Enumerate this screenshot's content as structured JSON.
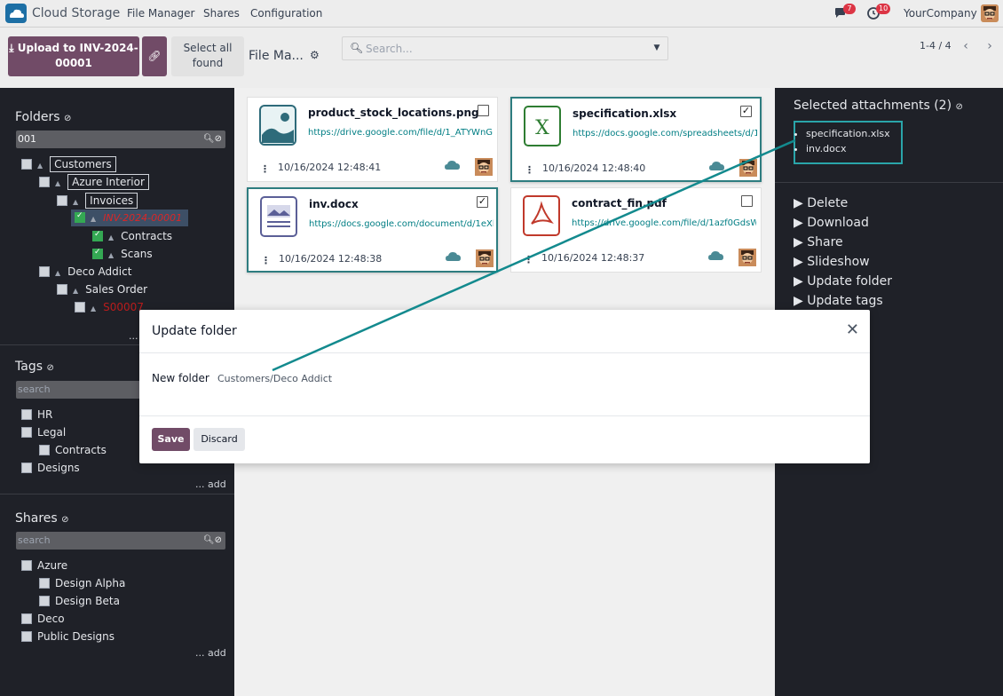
{
  "navbar": {
    "app_name": "Cloud Storage",
    "menus": [
      "File Manager",
      "Shares",
      "Configuration"
    ],
    "messages_count": "7",
    "activities_count": "10",
    "company": "YourCompany"
  },
  "control_panel": {
    "upload_label": "Upload to INV-2024-00001",
    "select_all_label": "Select all found",
    "breadcrumb": "File Ma...",
    "search_placeholder": "Search...",
    "pager": "1-4 / 4"
  },
  "sidebar": {
    "folders_title": "Folders",
    "folder_search_value": "001",
    "folders": [
      {
        "label": "Customers",
        "checked": false
      },
      {
        "label": "Azure Interior",
        "checked": false
      },
      {
        "label": "Invoices",
        "checked": false
      },
      {
        "label": "INV-2024-00001",
        "checked": true
      },
      {
        "label": "Contracts",
        "checked": true
      },
      {
        "label": "Scans",
        "checked": true
      },
      {
        "label": "Deco Addict",
        "checked": false
      },
      {
        "label": "Sales Order",
        "checked": false
      },
      {
        "label": "S00007",
        "checked": false
      }
    ],
    "folders_more": "...",
    "tags_title": "Tags",
    "tags_search_placeholder": "search",
    "tags": [
      {
        "label": "HR"
      },
      {
        "label": "Legal"
      },
      {
        "label": "Contracts"
      },
      {
        "label": "Designs"
      }
    ],
    "tags_add": "... add",
    "shares_title": "Shares",
    "shares_search_placeholder": "search",
    "shares": [
      {
        "label": "Azure"
      },
      {
        "label": "Design Alpha"
      },
      {
        "label": "Design Beta"
      },
      {
        "label": "Deco"
      },
      {
        "label": "Public Designs"
      }
    ],
    "shares_add": "... add"
  },
  "files": [
    {
      "name": "product_stock_locations.png",
      "url": "https://drive.google.com/file/d/1_ATYWnGqRXmRUsFz",
      "date": "10/16/2024 12:48:41",
      "selected": false,
      "icon": "image-file-icon"
    },
    {
      "name": "specification.xlsx",
      "url": "https://docs.google.com/spreadsheets/d/1bXq",
      "date": "10/16/2024 12:48:40",
      "selected": true,
      "icon": "spreadsheet-file-icon"
    },
    {
      "name": "inv.docx",
      "url": "https://docs.google.com/document/d/1eXkq",
      "date": "10/16/2024 12:48:38",
      "selected": true,
      "icon": "document-file-icon"
    },
    {
      "name": "contract_fin.pdf",
      "url": "https://drive.google.com/file/d/1azf0GdsWk",
      "date": "10/16/2024 12:48:37",
      "selected": false,
      "icon": "pdf-file-icon"
    }
  ],
  "right_panel": {
    "title": "Selected attachments (2)",
    "selected": [
      "specification.xlsx",
      "inv.docx"
    ],
    "actions": [
      "Delete",
      "Download",
      "Share",
      "Slideshow",
      "Update folder",
      "Update tags"
    ]
  },
  "modal": {
    "title": "Update folder",
    "field_label": "New folder",
    "field_value": "Customers/Deco Addict",
    "save_label": "Save",
    "discard_label": "Discard"
  },
  "colors": {
    "brand": "#714b67",
    "link": "#017e84",
    "sidebar_bg": "#1f2128",
    "highlight": "#2aa5aa"
  }
}
